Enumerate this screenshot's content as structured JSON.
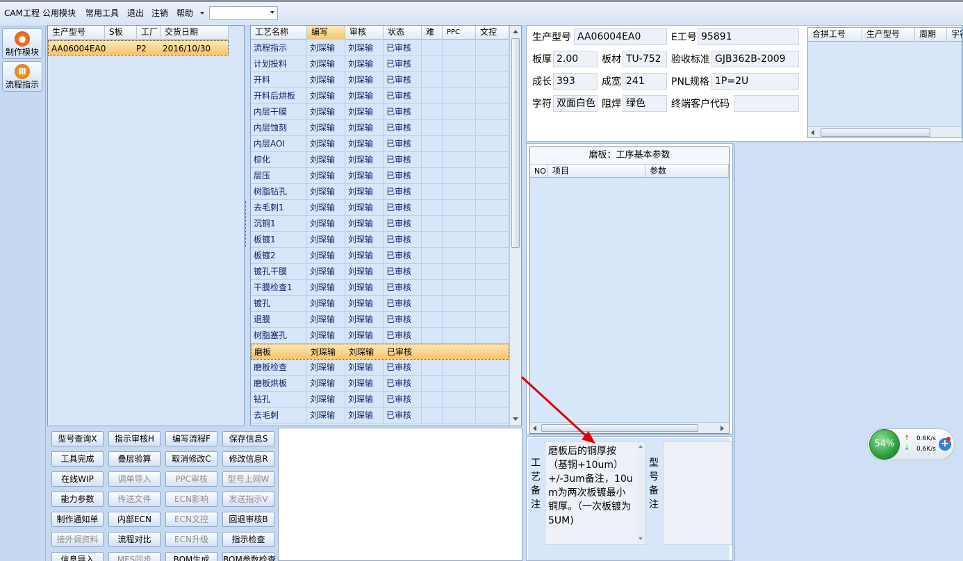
{
  "menu": {
    "items": [
      "CAM工程",
      "公用模块",
      "常用工具",
      "退出",
      "注销",
      "帮助"
    ],
    "combo_value": ""
  },
  "modules": [
    {
      "label": "制作模块",
      "icon": "flame-icon"
    },
    {
      "label": "流程指示",
      "icon": "process-icon"
    }
  ],
  "order_grid": {
    "columns": [
      "生产型号",
      "S板",
      "工厂",
      "交货日期"
    ],
    "rows": [
      [
        "AA06004EA0",
        "",
        "P2",
        "2016/10/30"
      ]
    ]
  },
  "process_grid": {
    "columns": [
      "工艺名称",
      "编写",
      "审核",
      "状态",
      "难",
      "PPC",
      "文控"
    ],
    "rows": [
      [
        "流程指示",
        "刘琛输",
        "刘琛输",
        "已审核"
      ],
      [
        "计划投料",
        "刘琛输",
        "刘琛输",
        "已审核"
      ],
      [
        "开料",
        "刘琛输",
        "刘琛输",
        "已审核"
      ],
      [
        "开料后烘板",
        "刘琛输",
        "刘琛输",
        "已审核"
      ],
      [
        "内层干膜",
        "刘琛输",
        "刘琛输",
        "已审核"
      ],
      [
        "内层蚀刻",
        "刘琛输",
        "刘琛输",
        "已审核"
      ],
      [
        "内层AOI",
        "刘琛输",
        "刘琛输",
        "已审核"
      ],
      [
        "棕化",
        "刘琛输",
        "刘琛输",
        "已审核"
      ],
      [
        "层压",
        "刘琛输",
        "刘琛输",
        "已审核"
      ],
      [
        "树脂钻孔",
        "刘琛输",
        "刘琛输",
        "已审核"
      ],
      [
        "去毛刺1",
        "刘琛输",
        "刘琛输",
        "已审核"
      ],
      [
        "沉铜1",
        "刘琛输",
        "刘琛输",
        "已审核"
      ],
      [
        "板镀1",
        "刘琛输",
        "刘琛输",
        "已审核"
      ],
      [
        "板镀2",
        "刘琛输",
        "刘琛输",
        "已审核"
      ],
      [
        "镀孔干膜",
        "刘琛输",
        "刘琛输",
        "已审核"
      ],
      [
        "干膜检查1",
        "刘琛输",
        "刘琛输",
        "已审核"
      ],
      [
        "镀孔",
        "刘琛输",
        "刘琛输",
        "已审核"
      ],
      [
        "退膜",
        "刘琛输",
        "刘琛输",
        "已审核"
      ],
      [
        "树脂塞孔",
        "刘琛输",
        "刘琛输",
        "已审核"
      ],
      [
        "磨板",
        "刘琛输",
        "刘琛输",
        "已审核"
      ],
      [
        "磨板检查",
        "刘琛输",
        "刘琛输",
        "已审核"
      ],
      [
        "磨板烘板",
        "刘琛输",
        "刘琛输",
        "已审核"
      ],
      [
        "钻孔",
        "刘琛输",
        "刘琛输",
        "已审核"
      ],
      [
        "去毛刺",
        "刘琛输",
        "刘琛输",
        "已审核"
      ]
    ],
    "selected_index": 19
  },
  "actions": {
    "buttons": [
      [
        "型号查询X",
        "指示审核H",
        "编写流程F",
        "保存信息S"
      ],
      [
        "工具完成",
        "叠层验算",
        "取消修改C",
        "修改信息R"
      ],
      [
        "在线WIP",
        "调单导入",
        "PPC审核",
        "型号上网W"
      ],
      [
        "能力参数",
        "传送文件",
        "ECN影响",
        "发送指示V"
      ],
      [
        "制作通知单",
        "内部ECN",
        "ECN文控",
        "回退审核B"
      ],
      [
        "接外调资料",
        "流程对比",
        "ECN升级",
        "指示检查"
      ],
      [
        "信息导入",
        "MES同步",
        "BOM生成",
        "BOM参数检查"
      ]
    ],
    "disabled": [
      "调单导入",
      "PPC审核",
      "型号上网W",
      "传送文件",
      "ECN影响",
      "发送指示V",
      "ECN文控",
      "接外调资料",
      "ECN升级",
      "MES同步"
    ]
  },
  "info": {
    "labels": {
      "model": "生产型号",
      "e_no": "E工号",
      "thickness": "板厚",
      "material": "板材",
      "standard": "验收标准",
      "length": "成长",
      "width": "成宽",
      "pnl": "PNL规格",
      "legend": "字符",
      "mask": "阻焊",
      "customer": "终端客户代码"
    },
    "values": {
      "model": "AA06004EA0",
      "e_no": "95891",
      "thickness": "2.00",
      "material": "TU-752",
      "standard": "GJB362B-2009",
      "length": "393",
      "width": "241",
      "pnl": "1P=2U",
      "legend": "双面白色",
      "mask": "绿色",
      "customer": ""
    }
  },
  "combine_grid": {
    "columns": [
      "合拼工号",
      "生产型号",
      "周期",
      "字符"
    ]
  },
  "param_panel": {
    "title": "磨板：工序基本参数",
    "columns": [
      "NO",
      "项目",
      "参数"
    ]
  },
  "remarks": {
    "process_label": "工艺备注",
    "process_text": "磨板后的铜厚按（基铜+10um）+/-3um备注，10um为两次板镀最小铜厚。（一次板镀为5UM)",
    "model_label": "型号备注"
  },
  "net_widget": {
    "percent": "54%",
    "up": "0.6K/s",
    "down": "0.6K/s"
  },
  "colors": {
    "selected_row": "#f9c36a",
    "arrow": "#e00000",
    "widget_green": "#2e9e3e"
  }
}
